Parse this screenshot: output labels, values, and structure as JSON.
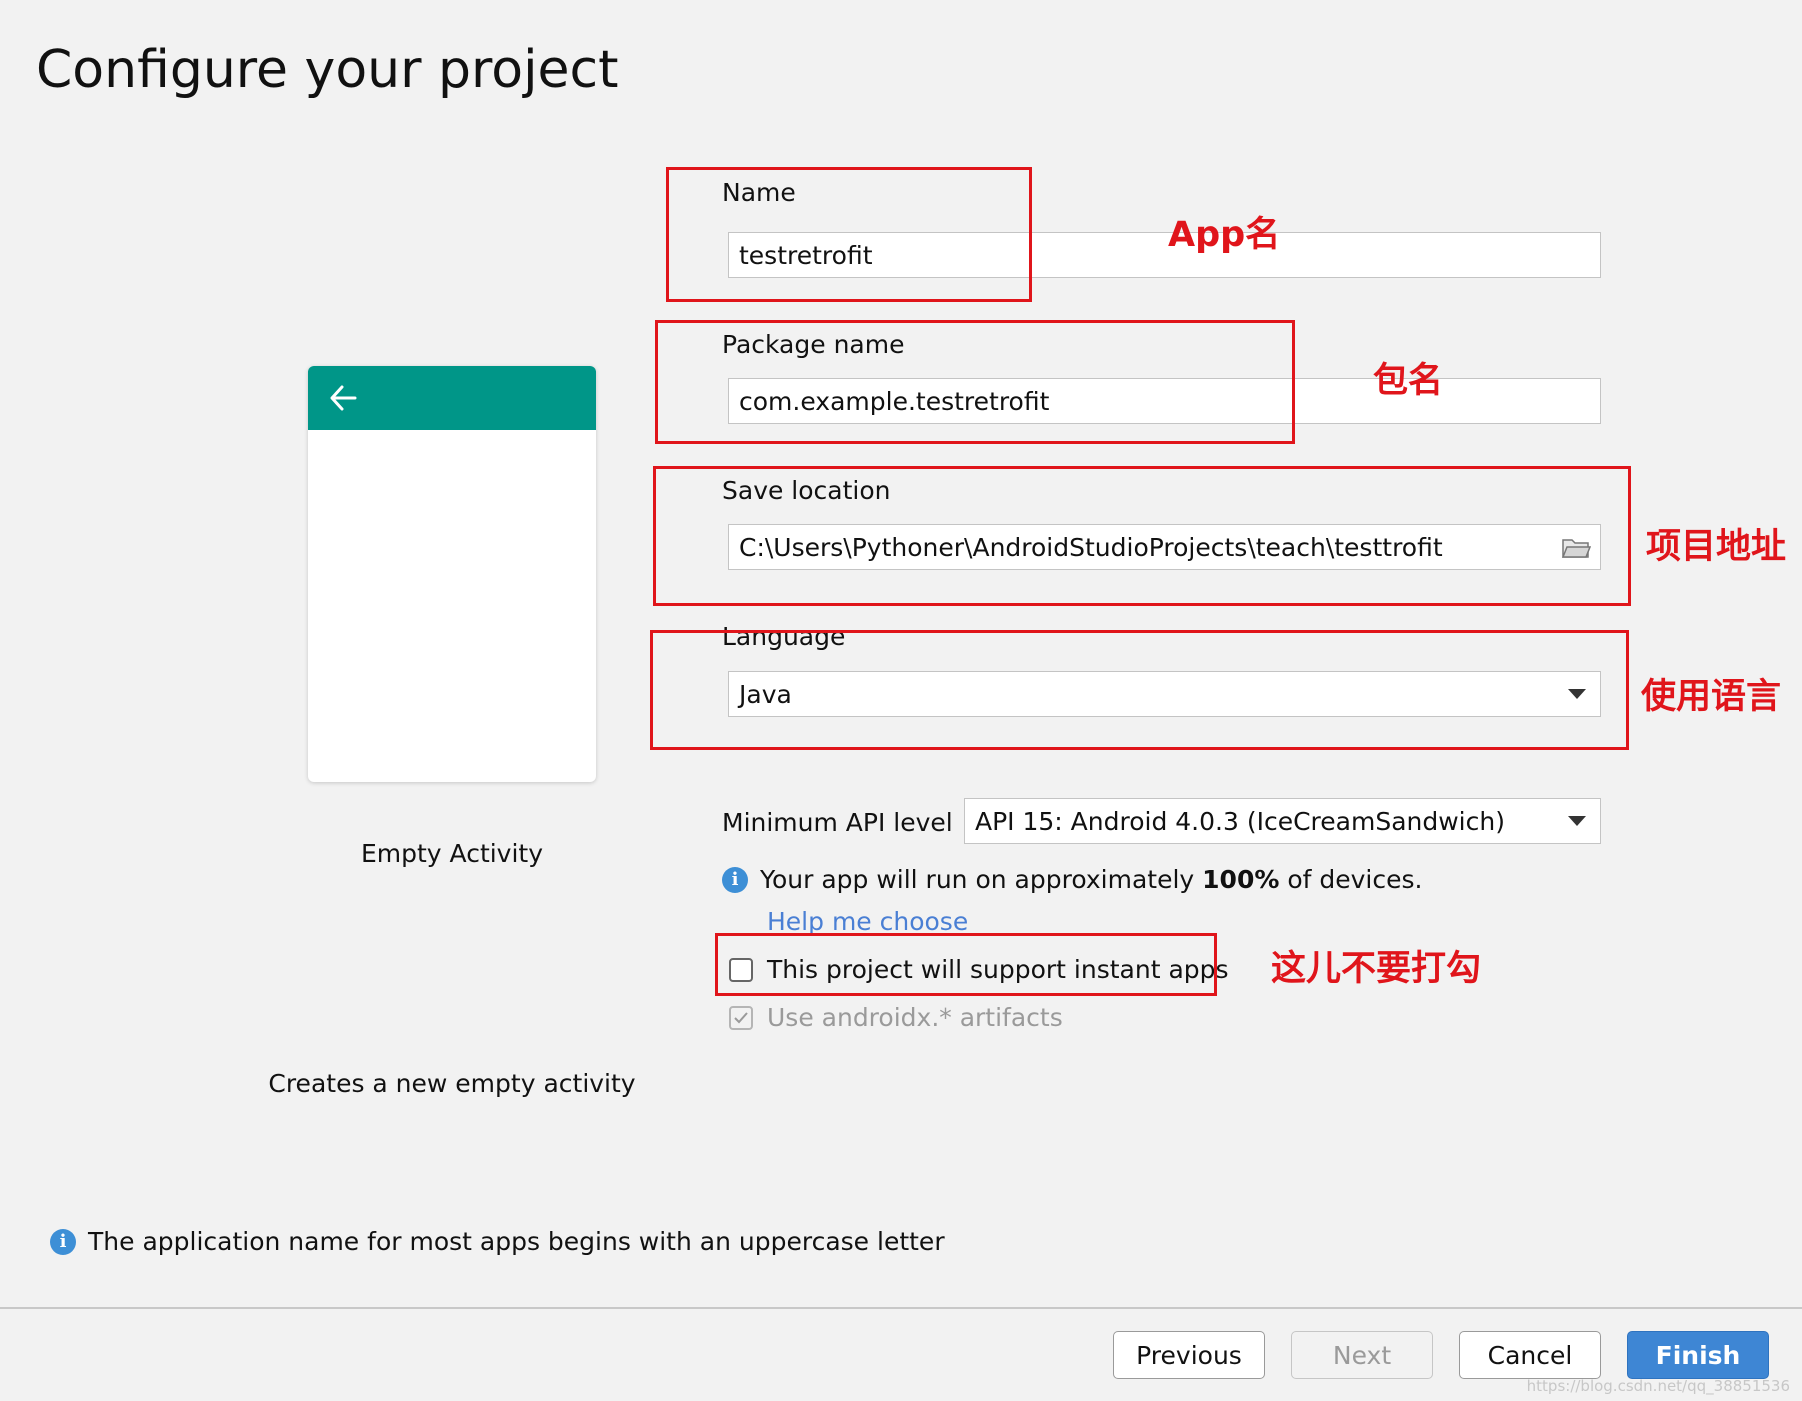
{
  "page": {
    "title": "Configure your project"
  },
  "template": {
    "activity_name": "Empty Activity",
    "activity_description": "Creates a new empty activity",
    "header_color": "#009688"
  },
  "form": {
    "name": {
      "label": "Name",
      "value": "testretrofit"
    },
    "package": {
      "label": "Package name",
      "value": "com.example.testretrofit"
    },
    "save_location": {
      "label": "Save location",
      "value": "C:\\Users\\Pythoner\\AndroidStudioProjects\\teach\\testtrofit"
    },
    "language": {
      "label": "Language",
      "value": "Java"
    },
    "min_api": {
      "label": "Minimum API level",
      "value": "API 15: Android 4.0.3 (IceCreamSandwich)"
    },
    "devices_info": {
      "prefix": "Your app will run on approximately ",
      "percent": "100%",
      "suffix": " of devices."
    },
    "help_link": "Help me choose",
    "instant_apps": {
      "label": "This project will support instant apps",
      "checked": false
    },
    "androidx": {
      "label": "Use androidx.* artifacts",
      "checked": true,
      "disabled": true
    }
  },
  "footer_info": "The application name for most apps begins with an uppercase letter",
  "buttons": {
    "previous": "Previous",
    "next": "Next",
    "cancel": "Cancel",
    "finish": "Finish"
  },
  "annotations": {
    "name": "App名",
    "package": "包名",
    "location": "项目地址",
    "language": "使用语言",
    "instant": "这儿不要打勾"
  },
  "watermark": "https://blog.csdn.net/qq_38851536",
  "colors": {
    "annotation": "#e0151b",
    "accent": "#3e86d4",
    "link": "#4a7fd4"
  }
}
